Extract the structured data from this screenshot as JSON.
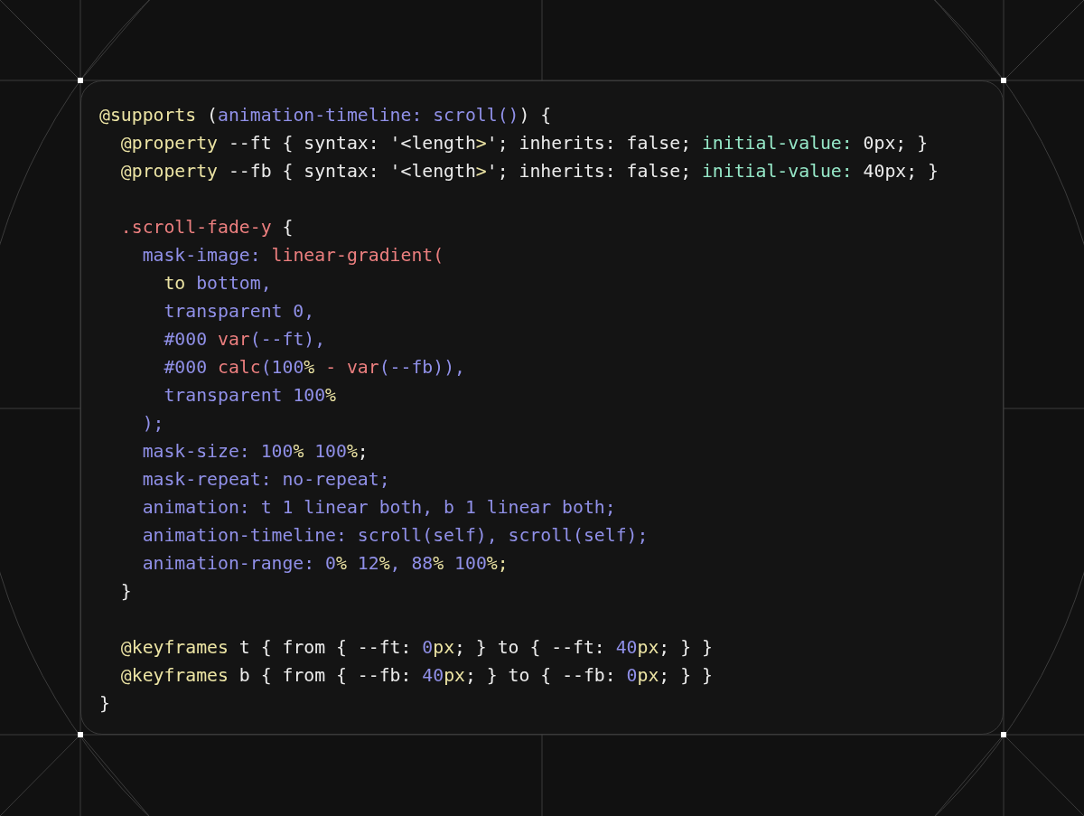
{
  "code_lines": [
    {
      "kind": "code",
      "tokens": [
        {
          "text": "@supports",
          "kind": "at"
        },
        {
          "text": " (",
          "kind": "plain"
        },
        {
          "text": "animation-timeline: scroll()",
          "kind": "prop"
        },
        {
          "text": ") {",
          "kind": "plain"
        }
      ]
    },
    {
      "kind": "code",
      "tokens": [
        {
          "text": "  @property",
          "kind": "at"
        },
        {
          "text": " --ft { syntax: '<length",
          "kind": "plain"
        },
        {
          "text": ">",
          "kind": "at"
        },
        {
          "text": "'; inherits: false; ",
          "kind": "plain"
        },
        {
          "text": "initial-value:",
          "kind": "accent"
        },
        {
          "text": " 0px; }",
          "kind": "plain"
        }
      ]
    },
    {
      "kind": "code",
      "tokens": [
        {
          "text": "  @property",
          "kind": "at"
        },
        {
          "text": " --fb { syntax: '<length",
          "kind": "plain"
        },
        {
          "text": ">",
          "kind": "at"
        },
        {
          "text": "'; inherits: false; ",
          "kind": "plain"
        },
        {
          "text": "initial-value:",
          "kind": "accent"
        },
        {
          "text": " 40px; }",
          "kind": "plain"
        }
      ]
    },
    {
      "kind": "blank"
    },
    {
      "kind": "code",
      "tokens": [
        {
          "text": "  .scroll-fade-y",
          "kind": "func"
        },
        {
          "text": " {",
          "kind": "plain"
        }
      ]
    },
    {
      "kind": "code",
      "tokens": [
        {
          "text": "    mask-image: ",
          "kind": "prop"
        },
        {
          "text": "linear-gradient(",
          "kind": "func"
        }
      ]
    },
    {
      "kind": "code",
      "tokens": [
        {
          "text": "      to",
          "kind": "at"
        },
        {
          "text": " bottom,",
          "kind": "prop"
        }
      ]
    },
    {
      "kind": "code",
      "tokens": [
        {
          "text": "      transparent 0,",
          "kind": "prop"
        }
      ]
    },
    {
      "kind": "code",
      "tokens": [
        {
          "text": "      #000 ",
          "kind": "prop"
        },
        {
          "text": "var",
          "kind": "func"
        },
        {
          "text": "(--ft),",
          "kind": "prop"
        }
      ]
    },
    {
      "kind": "code",
      "tokens": [
        {
          "text": "      #000 ",
          "kind": "prop"
        },
        {
          "text": "calc",
          "kind": "func"
        },
        {
          "text": "(100",
          "kind": "prop"
        },
        {
          "text": "%",
          "kind": "at"
        },
        {
          "text": " - var",
          "kind": "func"
        },
        {
          "text": "(--fb)),",
          "kind": "prop"
        }
      ]
    },
    {
      "kind": "code",
      "tokens": [
        {
          "text": "      transparent 100",
          "kind": "prop"
        },
        {
          "text": "%",
          "kind": "at"
        }
      ]
    },
    {
      "kind": "code",
      "tokens": [
        {
          "text": "    );",
          "kind": "prop"
        }
      ]
    },
    {
      "kind": "code",
      "tokens": [
        {
          "text": "    mask-size: 100",
          "kind": "prop"
        },
        {
          "text": "%",
          "kind": "at"
        },
        {
          "text": " 100",
          "kind": "prop"
        },
        {
          "text": "%",
          "kind": "at"
        },
        {
          "text": ";",
          "kind": "plain"
        }
      ]
    },
    {
      "kind": "code",
      "tokens": [
        {
          "text": "    mask-repeat: no-repeat;",
          "kind": "prop"
        }
      ]
    },
    {
      "kind": "code",
      "tokens": [
        {
          "text": "    animation: t 1 linear both, b 1 linear both;",
          "kind": "prop"
        }
      ]
    },
    {
      "kind": "code",
      "tokens": [
        {
          "text": "    animation-timeline: scroll(self), scroll(self);",
          "kind": "prop"
        }
      ]
    },
    {
      "kind": "code",
      "tokens": [
        {
          "text": "    animation-range: 0",
          "kind": "prop"
        },
        {
          "text": "%",
          "kind": "at"
        },
        {
          "text": " 12",
          "kind": "prop"
        },
        {
          "text": "%",
          "kind": "at"
        },
        {
          "text": ", 88",
          "kind": "prop"
        },
        {
          "text": "%",
          "kind": "at"
        },
        {
          "text": " 100",
          "kind": "prop"
        },
        {
          "text": "%;",
          "kind": "at"
        }
      ]
    },
    {
      "kind": "code",
      "tokens": [
        {
          "text": "  }",
          "kind": "plain"
        }
      ]
    },
    {
      "kind": "blank"
    },
    {
      "kind": "code",
      "tokens": [
        {
          "text": "  @keyframes",
          "kind": "at"
        },
        {
          "text": " t { from { --ft: ",
          "kind": "plain"
        },
        {
          "text": "0",
          "kind": "prop"
        },
        {
          "text": "px",
          "kind": "at"
        },
        {
          "text": "; } to { --ft: ",
          "kind": "plain"
        },
        {
          "text": "40",
          "kind": "prop"
        },
        {
          "text": "px",
          "kind": "at"
        },
        {
          "text": "; } }",
          "kind": "plain"
        }
      ]
    },
    {
      "kind": "code",
      "tokens": [
        {
          "text": "  @keyframes",
          "kind": "at"
        },
        {
          "text": " b { from { --fb: ",
          "kind": "plain"
        },
        {
          "text": "40",
          "kind": "prop"
        },
        {
          "text": "px",
          "kind": "at"
        },
        {
          "text": "; } to { --fb: ",
          "kind": "plain"
        },
        {
          "text": "0",
          "kind": "prop"
        },
        {
          "text": "px",
          "kind": "at"
        },
        {
          "text": "; } }",
          "kind": "plain"
        }
      ]
    },
    {
      "kind": "code",
      "tokens": [
        {
          "text": "}",
          "kind": "plain"
        }
      ]
    }
  ]
}
